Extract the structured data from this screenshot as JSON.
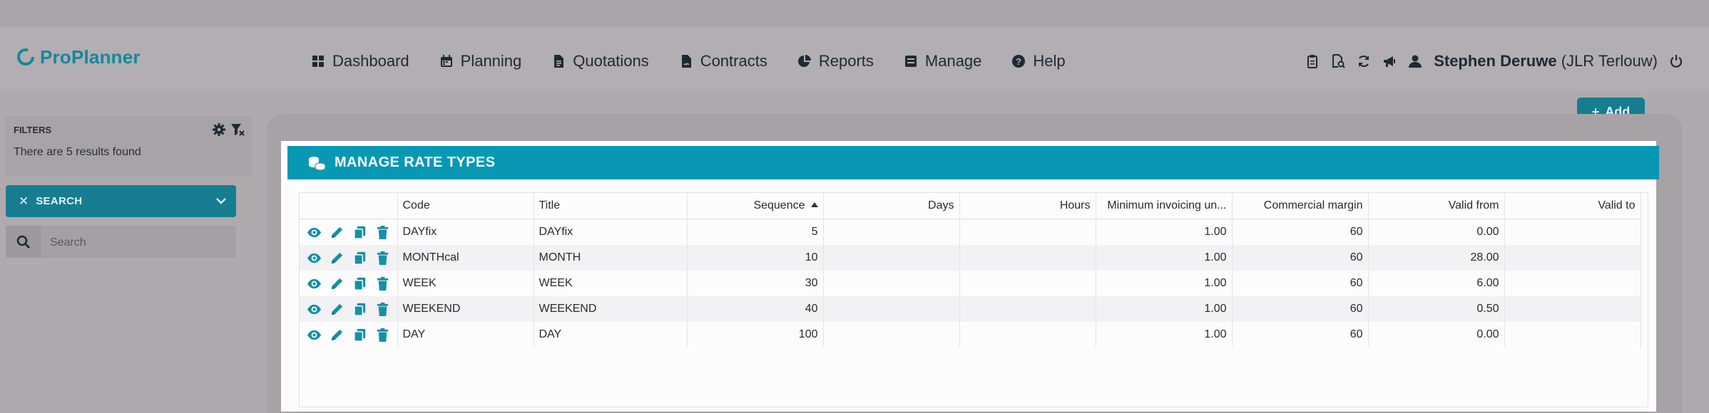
{
  "app": {
    "name": "ProPlanner"
  },
  "nav": [
    {
      "label": "Dashboard",
      "icon": "grid-icon"
    },
    {
      "label": "Planning",
      "icon": "calendar-icon"
    },
    {
      "label": "Quotations",
      "icon": "file-icon"
    },
    {
      "label": "Contracts",
      "icon": "contract-icon"
    },
    {
      "label": "Reports",
      "icon": "pie-chart-icon"
    },
    {
      "label": "Manage",
      "icon": "manage-icon"
    },
    {
      "label": "Help",
      "icon": "help-icon"
    }
  ],
  "user": {
    "name": "Stephen Deruwe",
    "company": "(JLR Terlouw)"
  },
  "filters": {
    "title": "FILTERS",
    "count_text": "There are 5 results found",
    "search_toggle_label": "SEARCH",
    "search_placeholder": "Search"
  },
  "toolbar": {
    "add_label": "Add"
  },
  "panel": {
    "title": "MANAGE RATE TYPES"
  },
  "table": {
    "columns": [
      "",
      "Code",
      "Title",
      "Sequence",
      "Days",
      "Hours",
      "Minimum invoicing un...",
      "Commercial margin",
      "Valid from",
      "Valid to"
    ],
    "sorted_column": "Sequence",
    "sort_direction": "ascending",
    "rows": [
      {
        "code": "DAYfix",
        "title": "DAYfix",
        "sequence": "5",
        "days": "",
        "hours": "",
        "min_invoicing": "1.00",
        "commercial_margin": "60",
        "valid_from": "0.00",
        "valid_to": ""
      },
      {
        "code": "MONTHcal",
        "title": "MONTH",
        "sequence": "10",
        "days": "",
        "hours": "",
        "min_invoicing": "1.00",
        "commercial_margin": "60",
        "valid_from": "28.00",
        "valid_to": ""
      },
      {
        "code": "WEEK",
        "title": "WEEK",
        "sequence": "30",
        "days": "",
        "hours": "",
        "min_invoicing": "1.00",
        "commercial_margin": "60",
        "valid_from": "6.00",
        "valid_to": ""
      },
      {
        "code": "WEEKEND",
        "title": "WEEKEND",
        "sequence": "40",
        "days": "",
        "hours": "",
        "min_invoicing": "1.00",
        "commercial_margin": "60",
        "valid_from": "0.50",
        "valid_to": ""
      },
      {
        "code": "DAY",
        "title": "DAY",
        "sequence": "100",
        "days": "",
        "hours": "",
        "min_invoicing": "1.00",
        "commercial_margin": "60",
        "valid_from": "0.00",
        "valid_to": ""
      }
    ]
  },
  "colors": {
    "accent": "#0898b3",
    "accent_dark": "#177d90",
    "logo": "#17879c",
    "action_icon": "#1590a6"
  }
}
